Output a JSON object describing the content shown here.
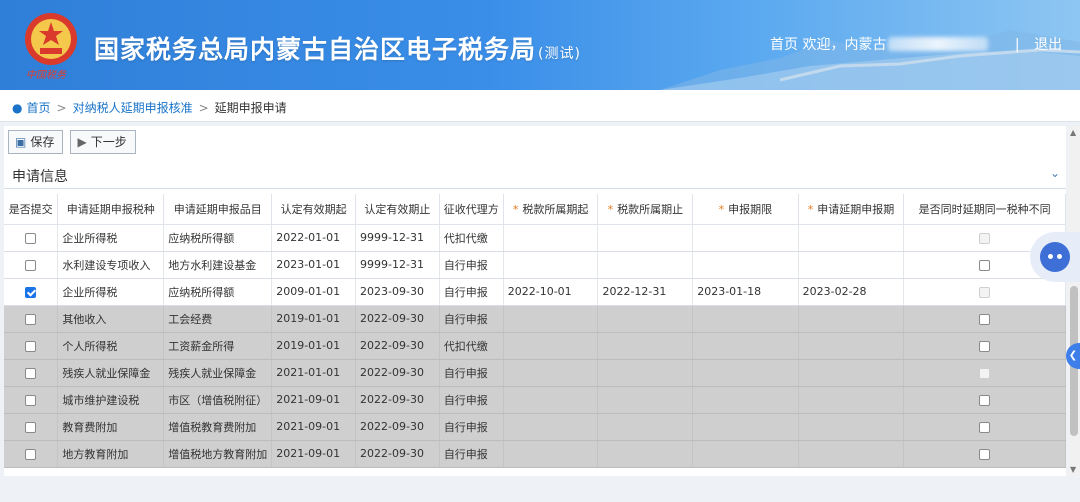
{
  "header": {
    "emblem_caption": "中国税务",
    "site_title": "国家税务总局内蒙古自治区电子税务局",
    "site_title_suffix": "(测试)",
    "home_link": "首页",
    "welcome": "欢迎，内蒙古",
    "logout": "退出"
  },
  "breadcrumb": {
    "items": [
      "首页",
      "对纳税人延期申报核准",
      "延期申报申请"
    ]
  },
  "toolbar": {
    "save_label": "保存",
    "next_label": "下一步"
  },
  "section": {
    "title": "申请信息"
  },
  "table": {
    "columns": [
      {
        "label": "是否提交",
        "required": false
      },
      {
        "label": "申请延期申报税种",
        "required": false
      },
      {
        "label": "申请延期申报品目",
        "required": false
      },
      {
        "label": "认定有效期起",
        "required": false
      },
      {
        "label": "认定有效期止",
        "required": false
      },
      {
        "label": "征收代理方",
        "required": false
      },
      {
        "label": "税款所属期起",
        "required": true
      },
      {
        "label": "税款所属期止",
        "required": true
      },
      {
        "label": "申报期限",
        "required": true
      },
      {
        "label": "申请延期申报期",
        "required": true
      },
      {
        "label": "是否同时延期同一税种不同",
        "required": false
      }
    ],
    "rows": [
      {
        "submit": false,
        "tax": "企业所得税",
        "item": "应纳税所得额",
        "from": "2022-01-01",
        "to": "9999-12-31",
        "agent": "代扣代缴",
        "period_from": "",
        "period_to": "",
        "deadline": "",
        "extended": "",
        "same": "disabled",
        "style": "white"
      },
      {
        "submit": false,
        "tax": "水利建设专项收入",
        "item": "地方水利建设基金",
        "from": "2023-01-01",
        "to": "9999-12-31",
        "agent": "自行申报",
        "period_from": "",
        "period_to": "",
        "deadline": "",
        "extended": "",
        "same": "off",
        "style": "white"
      },
      {
        "submit": true,
        "tax": "企业所得税",
        "item": "应纳税所得额",
        "from": "2009-01-01",
        "to": "2023-09-30",
        "agent": "自行申报",
        "period_from": "2022-10-01",
        "period_to": "2022-12-31",
        "deadline": "2023-01-18",
        "extended": "2023-02-28",
        "same": "disabled",
        "style": "white"
      },
      {
        "submit": false,
        "tax": "其他收入",
        "item": "工会经费",
        "from": "2019-01-01",
        "to": "2022-09-30",
        "agent": "自行申报",
        "period_from": "",
        "period_to": "",
        "deadline": "",
        "extended": "",
        "same": "off",
        "style": "grey"
      },
      {
        "submit": false,
        "tax": "个人所得税",
        "item": "工资薪金所得",
        "from": "2019-01-01",
        "to": "2022-09-30",
        "agent": "代扣代缴",
        "period_from": "",
        "period_to": "",
        "deadline": "",
        "extended": "",
        "same": "off",
        "style": "grey"
      },
      {
        "submit": false,
        "tax": "残疾人就业保障金",
        "item": "残疾人就业保障金",
        "from": "2021-01-01",
        "to": "2022-09-30",
        "agent": "自行申报",
        "period_from": "",
        "period_to": "",
        "deadline": "",
        "extended": "",
        "same": "disabled",
        "style": "grey"
      },
      {
        "submit": false,
        "tax": "城市维护建设税",
        "item": "市区（增值税附征）",
        "from": "2021-09-01",
        "to": "2022-09-30",
        "agent": "自行申报",
        "period_from": "",
        "period_to": "",
        "deadline": "",
        "extended": "",
        "same": "off",
        "style": "grey"
      },
      {
        "submit": false,
        "tax": "教育费附加",
        "item": "增值税教育费附加",
        "from": "2021-09-01",
        "to": "2022-09-30",
        "agent": "自行申报",
        "period_from": "",
        "period_to": "",
        "deadline": "",
        "extended": "",
        "same": "off",
        "style": "grey"
      },
      {
        "submit": false,
        "tax": "地方教育附加",
        "item": "增值税地方教育附加",
        "from": "2021-09-01",
        "to": "2022-09-30",
        "agent": "自行申报",
        "period_from": "",
        "period_to": "",
        "deadline": "",
        "extended": "",
        "same": "off",
        "style": "grey"
      }
    ]
  },
  "colors": {
    "header_blue": "#2f7fd8",
    "link_blue": "#1a73c8",
    "required_star": "#e87a1a",
    "disabled_row": "#cfcfcf"
  },
  "icons": [
    "location-pin-icon",
    "save-icon",
    "play-icon",
    "chevron-down-icon",
    "robot-assistant-icon",
    "chevron-left-icon"
  ]
}
